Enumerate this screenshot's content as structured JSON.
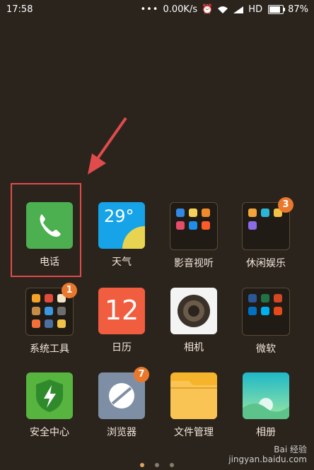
{
  "status": {
    "time": "17:58",
    "speed": "0.00K/s",
    "network": "HD",
    "battery": "87%"
  },
  "apps": [
    {
      "label": "电话"
    },
    {
      "label": "天气",
      "temperature": "29°"
    },
    {
      "label": "影音视听"
    },
    {
      "label": "休闲娱乐",
      "badge": "3"
    },
    {
      "label": "系统工具",
      "badge": "1"
    },
    {
      "label": "日历",
      "date": "12"
    },
    {
      "label": "相机"
    },
    {
      "label": "微软"
    },
    {
      "label": "安全中心"
    },
    {
      "label": "浏览器",
      "badge": "7"
    },
    {
      "label": "文件管理"
    },
    {
      "label": "相册"
    }
  ],
  "folder_icons": {
    "video": [
      "kuaishou",
      "youku",
      "video",
      "iqiyi",
      "alipay",
      "taobao"
    ],
    "games": [
      "game1",
      "game2",
      "game3",
      "game4"
    ],
    "tools": [
      "t1",
      "t2",
      "t3",
      "t4",
      "t5",
      "t6",
      "t7",
      "t8",
      "t9"
    ],
    "microsoft": [
      "word",
      "excel",
      "powerpoint",
      "outlook",
      "skype",
      "office"
    ]
  },
  "watermark": {
    "line1": "Bai 经验",
    "line2": "jingyan.baidu.com"
  },
  "colors": {
    "highlight": "#e04b4b",
    "badge": "#e9782c"
  }
}
